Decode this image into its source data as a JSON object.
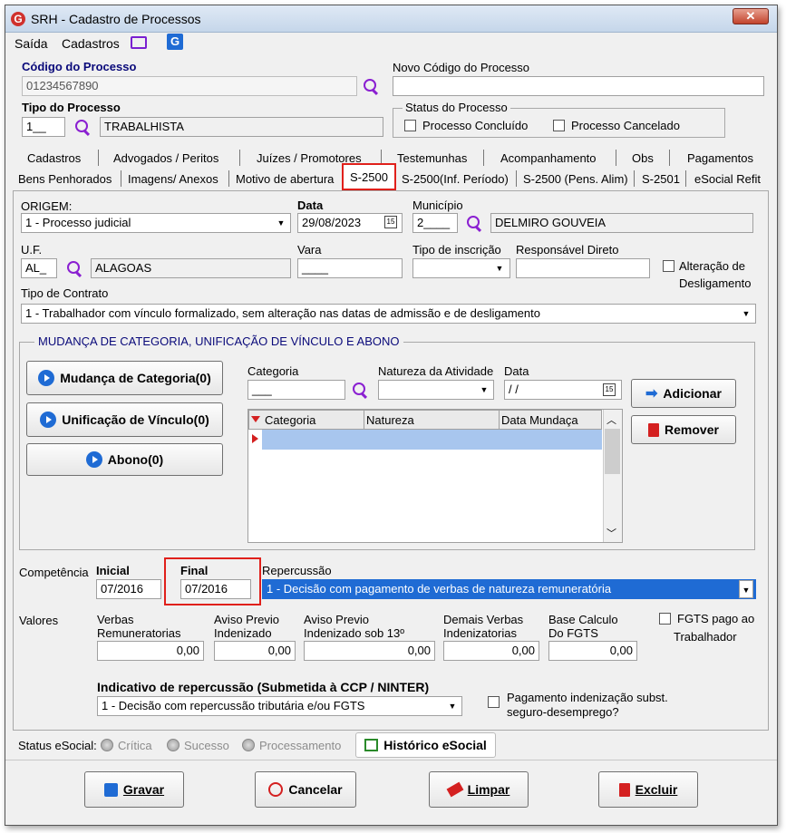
{
  "window": {
    "title": "SRH - Cadastro de Processos",
    "close": "✕"
  },
  "menu": {
    "saida": "Saída",
    "cadastros": "Cadastros"
  },
  "codigo": {
    "label": "Código do Processo",
    "value": "01234567890"
  },
  "novo_codigo": {
    "label": "Novo Código do Processo",
    "value": ""
  },
  "tipo": {
    "label": "Tipo do Processo",
    "code": "1__",
    "desc": "TRABALHISTA"
  },
  "status": {
    "label": "Status do Processo",
    "concluido": "Processo Concluído",
    "cancelado": "Processo Cancelado"
  },
  "tabs_row1": [
    "Cadastros",
    "Advogados / Peritos",
    "Juízes / Promotores",
    "Testemunhas",
    "Acompanhamento",
    "Obs",
    "Pagamentos"
  ],
  "tabs_row2": [
    "Bens Penhorados",
    "Imagens/ Anexos",
    "Motivo de abertura",
    "S-2500",
    "S-2500(Inf. Período)",
    "S-2500 (Pens. Alim)",
    "S-2501",
    "eSocial Refit"
  ],
  "origem": {
    "label": "ORIGEM:",
    "value": "1 - Processo judicial"
  },
  "data": {
    "label": "Data",
    "value": "29/08/2023"
  },
  "municipio": {
    "label": "Município",
    "code": "2____",
    "desc": "DELMIRO GOUVEIA"
  },
  "uf": {
    "label": "U.F.",
    "code": "AL_",
    "desc": "ALAGOAS"
  },
  "vara": {
    "label": "Vara",
    "value": "____"
  },
  "tipo_inscricao": {
    "label": "Tipo de inscrição",
    "value": ""
  },
  "responsavel": {
    "label": "Responsável Direto",
    "value": ""
  },
  "alteracao": {
    "line1": "Alteração de",
    "line2": "Desligamento"
  },
  "tipo_contrato": {
    "label": "Tipo de Contrato",
    "value": "1 - Trabalhador com vínculo formalizado, sem alteração nas datas de admissão e de desligamento"
  },
  "mudanca": {
    "title": "MUDANÇA DE CATEGORIA, UNIFICAÇÃO DE VÍNCULO E ABONO",
    "btn_categoria": "Mudança de Categoria(0)",
    "btn_unificacao": "Unificação de Vínculo(0)",
    "btn_abono": "Abono(0)",
    "categoria_label": "Categoria",
    "categoria_value": "___",
    "natureza_label": "Natureza da Atividade",
    "data_label": "Data",
    "data_value": " / /",
    "adicionar": "Adicionar",
    "remover": "Remover",
    "grid_headers": [
      "Categoria",
      "Natureza",
      "Data Mundaça"
    ]
  },
  "competencia": {
    "label": "Competência",
    "inicial_label": "Inicial",
    "inicial_value": "07/2016",
    "final_label": "Final",
    "final_value": "07/2016",
    "repercussao_label": "Repercussão",
    "repercussao_value": "1 - Decisão com pagamento de verbas de natureza remuneratória"
  },
  "valores": {
    "label": "Valores",
    "verbas_l1": "Verbas",
    "verbas_l2": "Remuneratorias",
    "verbas_value": "0,00",
    "aviso_l1": "Aviso Previo",
    "aviso_l2": "Indenizado",
    "aviso_value": "0,00",
    "aviso13_l1": "Aviso Previo",
    "aviso13_l2": "Indenizado sob 13º",
    "aviso13_value": "0,00",
    "demais_l1": "Demais Verbas",
    "demais_l2": "Indenizatorias",
    "demais_value": "0,00",
    "base_l1": "Base Calculo",
    "base_l2": "Do FGTS",
    "base_value": "0,00",
    "fgts_l1": "FGTS pago ao",
    "fgts_l2": "Trabalhador"
  },
  "indicativo": {
    "label": "Indicativo de repercussão (Submetida à CCP / NINTER)",
    "value": "1 - Decisão com repercussão tributária e/ou FGTS",
    "pag_l1": "Pagamento indenização subst.",
    "pag_l2": "seguro-desemprego?"
  },
  "esocial": {
    "label": "Status eSocial:",
    "critica": "Crítica",
    "sucesso": "Sucesso",
    "processamento": "Processamento",
    "historico": "Histórico eSocial"
  },
  "footer": {
    "gravar": "Gravar",
    "cancelar": "Cancelar",
    "limpar": "Limpar",
    "excluir": "Excluir"
  }
}
